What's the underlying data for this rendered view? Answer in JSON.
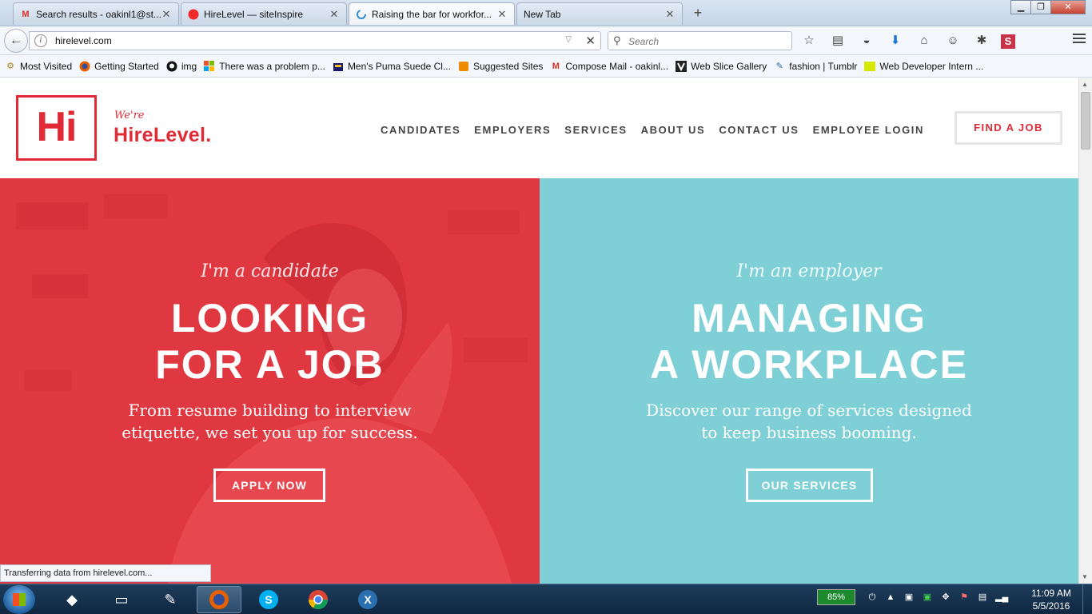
{
  "browser": {
    "tabs": [
      {
        "title": "Search results - oakinl1@st...",
        "icon": "gmail-icon"
      },
      {
        "title": "HireLevel — siteInspire",
        "icon": "siteinspire-icon"
      },
      {
        "title": "Raising the bar for workfor...",
        "icon": "loading-spinner-icon",
        "active": true
      },
      {
        "title": "New Tab",
        "icon": "blank-icon"
      }
    ],
    "url": "hirelevel.com",
    "search_placeholder": "Search",
    "bookmarks": [
      {
        "label": "Most Visited",
        "icon": "gear-icon"
      },
      {
        "label": "Getting Started",
        "icon": "firefox-icon"
      },
      {
        "label": "img",
        "icon": "github-icon"
      },
      {
        "label": "There was a problem p...",
        "icon": "windows-icon"
      },
      {
        "label": "Men's Puma Suede Cl...",
        "icon": "shop-icon"
      },
      {
        "label": "Suggested Sites",
        "icon": "suggested-icon"
      },
      {
        "label": "Compose Mail - oakinl...",
        "icon": "gmail-icon"
      },
      {
        "label": "Web Slice Gallery",
        "icon": "webslice-icon"
      },
      {
        "label": "fashion | Tumblr",
        "icon": "tumblr-icon"
      },
      {
        "label": "Web Developer Intern ...",
        "icon": "imre-icon"
      }
    ],
    "status": "Transferring data from hirelevel.com..."
  },
  "site": {
    "logo_mark": "Hi",
    "logo_tagline": "We're",
    "logo_name": "HireLevel.",
    "nav": [
      "CANDIDATES",
      "EMPLOYERS",
      "SERVICES",
      "ABOUT US",
      "CONTACT US",
      "EMPLOYEE LOGIN"
    ],
    "find_job": "FIND A JOB",
    "candidate": {
      "kicker": "I'm a candidate",
      "headline_1": "LOOKING",
      "headline_2": "FOR A JOB",
      "desc_1": "From resume building to interview",
      "desc_2": "etiquette, we set you up for success.",
      "cta": "APPLY NOW",
      "color": "#e33b44"
    },
    "employer": {
      "kicker": "I'm an employer",
      "headline_1": "MANAGING",
      "headline_2": "A WORKPLACE",
      "desc_1": "Discover our range of services designed",
      "desc_2": "to keep business booming.",
      "cta": "OUR SERVICES",
      "color": "#7ecfd6"
    }
  },
  "taskbar": {
    "apps": [
      "virtualbox-icon",
      "file-explorer-icon",
      "notepad-icon",
      "firefox-icon",
      "skype-icon",
      "chrome-icon",
      "xmind-icon"
    ],
    "battery": "85%",
    "time": "11:09 AM",
    "date": "5/5/2016"
  }
}
